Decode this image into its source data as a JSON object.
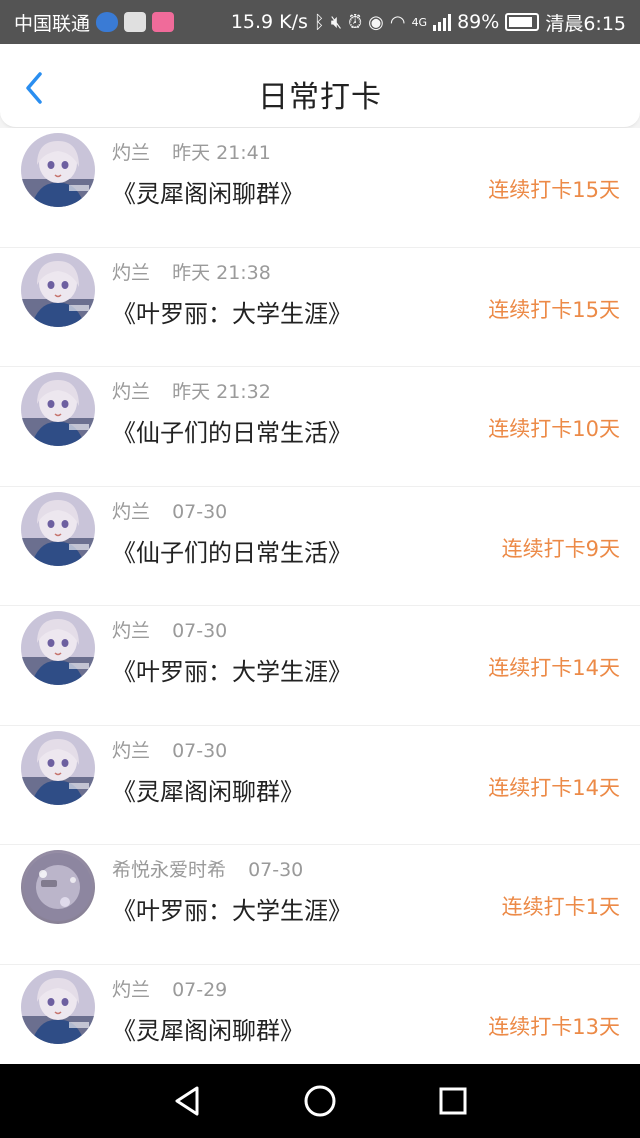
{
  "status_bar": {
    "carrier": "中国联通",
    "net_speed": "15.9 K/s",
    "network_type": "4G",
    "battery": "89%",
    "battery_level": 0.89,
    "time": "清晨6:15",
    "app_icon_colors": [
      "#3a7bd5",
      "#e0e0e0",
      "#f06b9a"
    ]
  },
  "header": {
    "back_icon": "chevron-left-icon",
    "title": "日常打卡",
    "accent_color": "#2a8ef0"
  },
  "checkins": [
    {
      "name": "灼兰",
      "time": "昨天 21:41",
      "book": "《灵犀阁闲聊群》",
      "streak": "连续打卡15天",
      "avatar": "anime-girl-avatar"
    },
    {
      "name": "灼兰",
      "time": "昨天 21:38",
      "book": "《叶罗丽：大学生涯》",
      "streak": "连续打卡15天",
      "avatar": "anime-girl-avatar"
    },
    {
      "name": "灼兰",
      "time": "昨天 21:32",
      "book": "《仙子们的日常生活》",
      "streak": "连续打卡10天",
      "avatar": "anime-girl-avatar"
    },
    {
      "name": "灼兰",
      "time": "07-30",
      "book": "《仙子们的日常生活》",
      "streak": "连续打卡9天",
      "avatar": "anime-girl-avatar"
    },
    {
      "name": "灼兰",
      "time": "07-30",
      "book": "《叶罗丽：大学生涯》",
      "streak": "连续打卡14天",
      "avatar": "anime-girl-avatar"
    },
    {
      "name": "灼兰",
      "time": "07-30",
      "book": "《灵犀阁闲聊群》",
      "streak": "连续打卡14天",
      "avatar": "anime-girl-avatar"
    },
    {
      "name": "希悦永爱时希",
      "time": "07-30",
      "book": "《叶罗丽：大学生涯》",
      "streak": "连续打卡1天",
      "avatar": "sparkle-avatar"
    },
    {
      "name": "灼兰",
      "time": "07-29",
      "book": "《灵犀阁闲聊群》",
      "streak": "连续打卡13天",
      "avatar": "anime-girl-avatar"
    }
  ],
  "nav_bar": {
    "back": "triangle-back-icon",
    "home": "circle-home-icon",
    "recent": "square-recent-icon"
  },
  "colors": {
    "streak": "#ec8a47",
    "meta": "#9a9a9a",
    "title": "#222222"
  }
}
